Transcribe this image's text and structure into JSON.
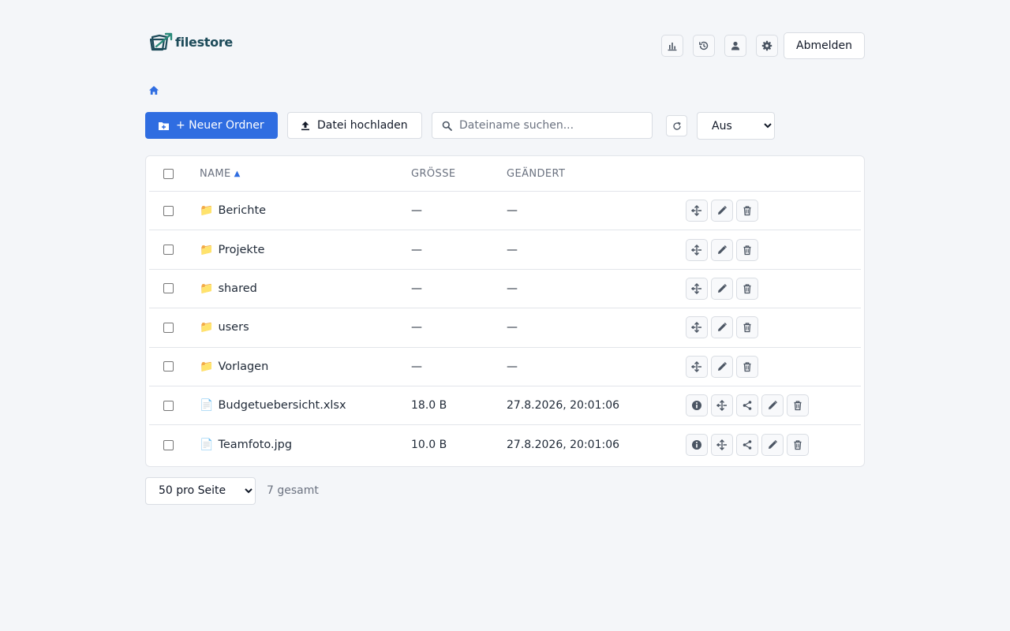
{
  "header": {
    "logo_text": "filestore",
    "logout_label": "Abmelden",
    "icons": [
      "bar-chart-icon",
      "history-icon",
      "user-icon",
      "gear-icon"
    ]
  },
  "toolbar": {
    "new_folder_label": "+ Neuer Ordner",
    "upload_label": "Datei hochladen",
    "search_placeholder": "Dateiname suchen...",
    "filter_selected": "Aus"
  },
  "table": {
    "columns": {
      "name": "NAME",
      "size": "GRÖSSE",
      "modified": "GEÄNDERT"
    },
    "rows": [
      {
        "type": "folder",
        "icon": "📁",
        "name": "Berichte",
        "size": "—",
        "modified": "—"
      },
      {
        "type": "folder",
        "icon": "📁",
        "name": "Projekte",
        "size": "—",
        "modified": "—"
      },
      {
        "type": "folder",
        "icon": "📁",
        "name": "shared",
        "size": "—",
        "modified": "—"
      },
      {
        "type": "folder",
        "icon": "📁",
        "name": "users",
        "size": "—",
        "modified": "—"
      },
      {
        "type": "folder",
        "icon": "📁",
        "name": "Vorlagen",
        "size": "—",
        "modified": "—"
      },
      {
        "type": "file",
        "icon": "📄",
        "name": "Budgetuebersicht.xlsx",
        "size": "18.0 B",
        "modified": "27.8.2026, 20:01:06"
      },
      {
        "type": "file",
        "icon": "📄",
        "name": "Teamfoto.jpg",
        "size": "10.0 B",
        "modified": "27.8.2026, 20:01:06"
      }
    ]
  },
  "footer": {
    "per_page": "50 pro Seite",
    "total": "7 gesamt"
  },
  "colors": {
    "accent": "#2f6de1",
    "logo": "#1d4b5a",
    "background": "#f4f6f9"
  }
}
